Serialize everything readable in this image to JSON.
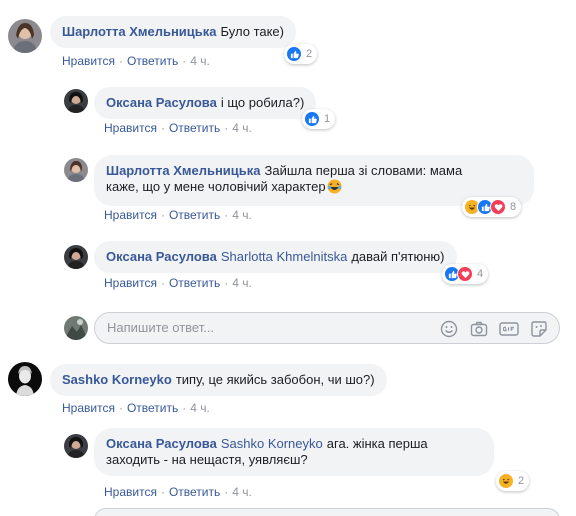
{
  "comments": [
    {
      "author": "Шарлотта Хмельницька",
      "text": "Було таке)",
      "reaction_count": "2"
    },
    {
      "author": "Оксана Расулова",
      "text": "і що робила?)",
      "reaction_count": "1"
    },
    {
      "author": "Шарлотта Хмельницька",
      "text_line1": "Зайшла перша зі словами: мама",
      "text_line2": "каже, що у мене чоловічий характер",
      "reaction_count": "8"
    },
    {
      "author": "Оксана Расулова",
      "mention": "Sharlotta Khmelnitska",
      "text": "давай п'ятюню)",
      "reaction_count": "4"
    },
    {
      "author": "Sashko Korneyko",
      "text": "типу, це якийсь забобон, чи шо?)"
    },
    {
      "author": "Оксана Расулова",
      "mention": "Sashko Korneyko",
      "text_line1": "ага. жінка перша",
      "text_line2": "заходить - на нещастя, уявляєш?",
      "reaction_count": "2"
    }
  ],
  "actions": {
    "like": "Нравится",
    "reply": "Ответить",
    "dot": "·",
    "time": "4 ч."
  },
  "reply_box": {
    "placeholder": "Напишите ответ..."
  },
  "icons": [
    "smile-icon",
    "camera-icon",
    "gif-icon",
    "sticker-icon"
  ],
  "colors": {
    "link": "#385898",
    "bubble": "#f2f3f5",
    "like": "#1877f2",
    "haha": "#f7b125",
    "love": "#f33e58"
  }
}
